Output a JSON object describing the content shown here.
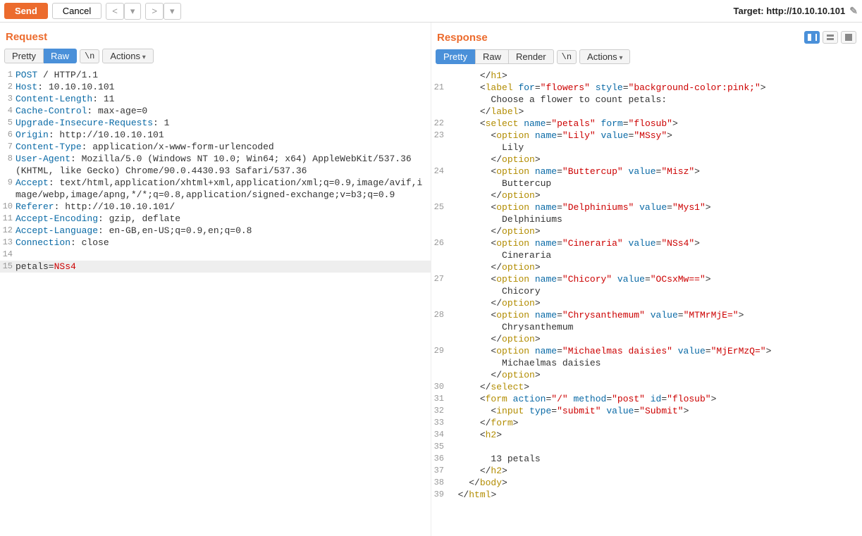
{
  "toolbar": {
    "send": "Send",
    "cancel": "Cancel",
    "prev": "<",
    "next": ">",
    "prev_menu": "▾",
    "next_menu": "▾",
    "target_label": "Target: http://10.10.10.101"
  },
  "request": {
    "title": "Request",
    "tabs": {
      "pretty": "Pretty",
      "raw": "Raw",
      "newline": "\\n",
      "actions": "Actions"
    },
    "active_tab": "raw",
    "lines": [
      {
        "n": 1,
        "kind": "start",
        "method": "POST",
        "rest": " / HTTP/1.1"
      },
      {
        "n": 2,
        "kind": "header",
        "name": "Host",
        "value": " 10.10.10.101"
      },
      {
        "n": 3,
        "kind": "header",
        "name": "Content-Length",
        "value": " 11"
      },
      {
        "n": 4,
        "kind": "header",
        "name": "Cache-Control",
        "value": " max-age=0"
      },
      {
        "n": 5,
        "kind": "header",
        "name": "Upgrade-Insecure-Requests",
        "value": " 1"
      },
      {
        "n": 6,
        "kind": "header",
        "name": "Origin",
        "value": " http://10.10.10.101"
      },
      {
        "n": 7,
        "kind": "header",
        "name": "Content-Type",
        "value": " application/x-www-form-urlencoded"
      },
      {
        "n": 8,
        "kind": "header",
        "name": "User-Agent",
        "value": " Mozilla/5.0 (Windows NT 10.0; Win64; x64) AppleWebKit/537.36 (KHTML, like Gecko) Chrome/90.0.4430.93 Safari/537.36"
      },
      {
        "n": 9,
        "kind": "header",
        "name": "Accept",
        "value": " text/html,application/xhtml+xml,application/xml;q=0.9,image/avif,image/webp,image/apng,*/*;q=0.8,application/signed-exchange;v=b3;q=0.9"
      },
      {
        "n": 10,
        "kind": "header",
        "name": "Referer",
        "value": " http://10.10.10.101/"
      },
      {
        "n": 11,
        "kind": "header",
        "name": "Accept-Encoding",
        "value": " gzip, deflate"
      },
      {
        "n": 12,
        "kind": "header",
        "name": "Accept-Language",
        "value": " en-GB,en-US;q=0.9,en;q=0.8"
      },
      {
        "n": 13,
        "kind": "header",
        "name": "Connection",
        "value": " close"
      },
      {
        "n": 14,
        "kind": "blank"
      },
      {
        "n": 15,
        "kind": "body",
        "name": "petals",
        "value": "NSs4",
        "hl": true
      }
    ]
  },
  "response": {
    "title": "Response",
    "tabs": {
      "pretty": "Pretty",
      "raw": "Raw",
      "render": "Render",
      "newline": "\\n",
      "actions": "Actions"
    },
    "active_tab": "pretty",
    "lines": [
      {
        "n": "",
        "html": "      </<t>h1</t>>"
      },
      {
        "n": 21,
        "html": "      <<t>label</t> <a>for</a>=<v>\"flowers\"</v> <a>style</a>=<v>\"background-color:pink;\"</v>>"
      },
      {
        "n": "",
        "html": "        Choose a flower to count petals:"
      },
      {
        "n": "",
        "html": "      </<t>label</t>>"
      },
      {
        "n": 22,
        "html": "      <<t>select</t> <a>name</a>=<v>\"petals\"</v> <a>form</a>=<v>\"flosub\"</v>>"
      },
      {
        "n": 23,
        "html": "        <<t>option</t> <a>name</a>=<v>\"Lily\"</v> <a>value</a>=<v>\"MSsy\"</v>>"
      },
      {
        "n": "",
        "html": "          Lily"
      },
      {
        "n": "",
        "html": "        </<t>option</t>>"
      },
      {
        "n": 24,
        "html": "        <<t>option</t> <a>name</a>=<v>\"Buttercup\"</v> <a>value</a>=<v>\"Misz\"</v>>"
      },
      {
        "n": "",
        "html": "          Buttercup"
      },
      {
        "n": "",
        "html": "        </<t>option</t>>"
      },
      {
        "n": 25,
        "html": "        <<t>option</t> <a>name</a>=<v>\"Delphiniums\"</v> <a>value</a>=<v>\"Mys1\"</v>>"
      },
      {
        "n": "",
        "html": "          Delphiniums"
      },
      {
        "n": "",
        "html": "        </<t>option</t>>"
      },
      {
        "n": 26,
        "html": "        <<t>option</t> <a>name</a>=<v>\"Cineraria\"</v> <a>value</a>=<v>\"NSs4\"</v>>"
      },
      {
        "n": "",
        "html": "          Cineraria"
      },
      {
        "n": "",
        "html": "        </<t>option</t>>"
      },
      {
        "n": 27,
        "html": "        <<t>option</t> <a>name</a>=<v>\"Chicory\"</v> <a>value</a>=<v>\"OCsxMw==\"</v>>"
      },
      {
        "n": "",
        "html": "          Chicory"
      },
      {
        "n": "",
        "html": "        </<t>option</t>>"
      },
      {
        "n": 28,
        "html": "        <<t>option</t> <a>name</a>=<v>\"Chrysanthemum\"</v> <a>value</a>=<v>\"MTMrMjE=\"</v>>"
      },
      {
        "n": "",
        "html": "          Chrysanthemum"
      },
      {
        "n": "",
        "html": "        </<t>option</t>>"
      },
      {
        "n": 29,
        "html": "        <<t>option</t> <a>name</a>=<v>\"Michaelmas daisies\"</v> <a>value</a>=<v>\"MjErMzQ=\"</v>>"
      },
      {
        "n": "",
        "html": "          Michaelmas daisies"
      },
      {
        "n": "",
        "html": "        </<t>option</t>>"
      },
      {
        "n": 30,
        "html": "      </<t>select</t>>"
      },
      {
        "n": "",
        "html": ""
      },
      {
        "n": 31,
        "html": "      <<t>form</t> <a>action</a>=<v>\"/\"</v> <a>method</a>=<v>\"post\"</v> <a>id</a>=<v>\"flosub\"</v>>"
      },
      {
        "n": 32,
        "html": "        <<t>input</t> <a>type</a>=<v>\"submit\"</v> <a>value</a>=<v>\"Submit\"</v>>"
      },
      {
        "n": 33,
        "html": "      </<t>form</t>>"
      },
      {
        "n": 34,
        "html": "      <<t>h2</t>>"
      },
      {
        "n": 35,
        "html": ""
      },
      {
        "n": 36,
        "html": "        13 petals"
      },
      {
        "n": 37,
        "html": "      </<t>h2</t>>"
      },
      {
        "n": 38,
        "html": "    </<t>body</t>>"
      },
      {
        "n": 39,
        "html": "  </<t>html</t>>"
      }
    ]
  }
}
